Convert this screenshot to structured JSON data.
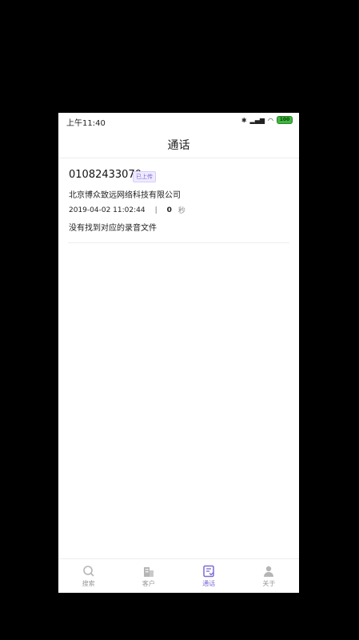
{
  "status": {
    "time": "上午11:40",
    "battery": "100"
  },
  "header": {
    "title": "通话"
  },
  "record": {
    "phone_number": "01082433070",
    "upload_badge": "已上传",
    "company": "北京博众致远网络科技有限公司",
    "datetime": "2019-04-02 11:02:44",
    "separator": "|",
    "duration": "0",
    "duration_unit": "秒",
    "note": "没有找到对应的录音文件"
  },
  "tabs": [
    {
      "label": "搜索",
      "icon": "search-icon"
    },
    {
      "label": "客户",
      "icon": "building-icon"
    },
    {
      "label": "通话",
      "icon": "call-log-icon",
      "active": true
    },
    {
      "label": "关于",
      "icon": "person-icon"
    }
  ],
  "colors": {
    "accent": "#7b6bd6",
    "battery": "#3db83d"
  }
}
